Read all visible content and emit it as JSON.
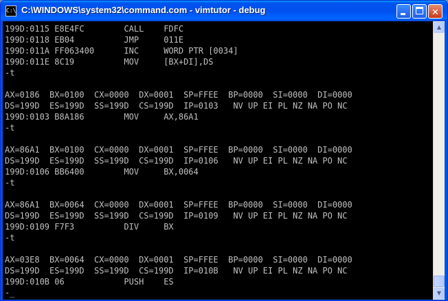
{
  "window": {
    "title": "C:\\WINDOWS\\system32\\command.com - vimtutor - debug",
    "icon": "console-icon",
    "icon_text": "C:\\",
    "minimize_icon": "minimize-icon",
    "maximize_icon": "maximize-icon",
    "close_icon": "close-icon",
    "close_glyph": "✕"
  },
  "scrollbar": {
    "up_arrow": "▲",
    "down_arrow": "▼"
  },
  "colors": {
    "titlebar": "#0053e3",
    "console_background": "#000000",
    "console_text": "#c0c0c0",
    "close_button": "#c8391c"
  },
  "console": {
    "lines": [
      "199D:0115 E8E4FC        CALL    FDFC",
      "199D:0118 EB04          JMP     011E",
      "199D:011A FF063400      INC     WORD PTR [0034]",
      "199D:011E 8C19          MOV     [BX+DI],DS",
      "-t",
      "",
      "AX=0186  BX=0100  CX=0000  DX=0001  SP=FFEE  BP=0000  SI=0000  DI=0000",
      "DS=199D  ES=199D  SS=199D  CS=199D  IP=0103   NV UP EI PL NZ NA PO NC",
      "199D:0103 B8A186        MOV     AX,86A1",
      "-t",
      "",
      "AX=86A1  BX=0100  CX=0000  DX=0001  SP=FFEE  BP=0000  SI=0000  DI=0000",
      "DS=199D  ES=199D  SS=199D  CS=199D  IP=0106   NV UP EI PL NZ NA PO NC",
      "199D:0106 BB6400        MOV     BX,0064",
      "-t",
      "",
      "AX=86A1  BX=0064  CX=0000  DX=0001  SP=FFEE  BP=0000  SI=0000  DI=0000",
      "DS=199D  ES=199D  SS=199D  CS=199D  IP=0109   NV UP EI PL NZ NA PO NC",
      "199D:0109 F7F3          DIV     BX",
      "-t",
      "",
      "AX=03E8  BX=0064  CX=0000  DX=0001  SP=FFEE  BP=0000  SI=0000  DI=0000",
      "DS=199D  ES=199D  SS=199D  CS=199D  IP=010B   NV UP EI PL NZ NA PO NC",
      "199D:010B 06            PUSH    ES",
      "-_"
    ]
  }
}
